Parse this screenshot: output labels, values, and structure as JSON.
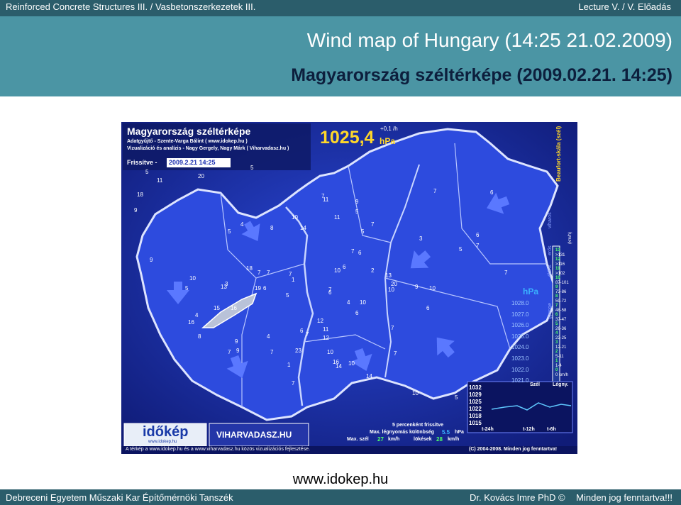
{
  "header": {
    "course": "Reinforced Concrete Structures III. / Vasbetonszerkezetek III.",
    "lecture": "Lecture V. / V. Előadás"
  },
  "slide": {
    "title_en": "Wind map of Hungary (14:25 21.02.2009)",
    "title_hu": "Magyarország széltérképe (2009.02.21. 14:25)",
    "source_url": "www.idokep.hu"
  },
  "map": {
    "heading": "Magyarország széltérképe",
    "collector": "Adatgyűjtő - Szente-Varga Bálint ( www.idokep.hu )",
    "visualization": "Vizualizáció és analízis - Nagy Gergely, Nagy Márk ( Viharvadasz.hu )",
    "refreshed_label": "Frissítve -",
    "refreshed_value": "2009.2.21  14:25",
    "pressure_value": "1025,4",
    "pressure_unit": "hPa",
    "pressure_change": "+0,1 /h",
    "scale_hpa_label": "hPa",
    "scale_hpa_values": [
      "1028.0",
      "1027.0",
      "1026.0",
      "1025.0",
      "1024.0",
      "1023.0",
      "1022.0",
      "1021.0"
    ],
    "beaufort_title": "Beaufort-skála (szél)",
    "beaufort_unit": "(km/h)",
    "beaufort_levels": [
      "13",
      "12",
      "11",
      "10",
      "9",
      "8",
      "7",
      "6",
      "5",
      "4",
      "3",
      "2",
      "1",
      "0"
    ],
    "beaufort_ranges": [
      ">131",
      ">116",
      ">102",
      "87-101",
      "73-86",
      "59-72",
      "48-58",
      "37-47",
      "26-36",
      "22-25",
      "12-21",
      "5-11",
      "1-4",
      "0 km/h"
    ],
    "intensity_words": [
      "viharos",
      "erős",
      "élénk",
      "gyenge"
    ],
    "legend_szel": "Szél",
    "legend_legny": "Légny.",
    "mini_chart_values": [
      "1032",
      "1029",
      "1025",
      "1022",
      "1018",
      "1015"
    ],
    "mini_chart_ticks": [
      "t-24h",
      "t-12h",
      "t-6h"
    ],
    "logo_idokep": "időkép",
    "logo_idokep_url": "www.idokep.hu",
    "logo_vihar": "VIHARVADASZ.HU",
    "stats_pressure_label": "Max. légnyomás különbség",
    "stats_pressure_value": "5.5",
    "stats_pressure_unit": "hPa",
    "stats_wind_label": "Max. szél",
    "stats_wind_value": "27",
    "stats_wind_unit": "km/h",
    "stats_gust_label": "lökések",
    "stats_gust_value": "28",
    "stats_gust_unit": "km/h",
    "refresh_note": "5 percenként frissítve",
    "footer_left": "A térkép a www.idokep.hu és a www.viharvadasz.hu közös vizualizációs fejlesztése.",
    "footer_right": "(C) 2004-2008. Minden jog fenntartva!",
    "station_values": [
      "5",
      "11",
      "20",
      "5",
      "18",
      "9",
      "9",
      "5",
      "4",
      "5",
      "8",
      "10",
      "14",
      "7",
      "11",
      "11",
      "5",
      "9",
      "7",
      "5",
      "3",
      "7",
      "6",
      "6",
      "10",
      "2",
      "7",
      "6",
      "4",
      "10",
      "6",
      "13",
      "18",
      "7",
      "7",
      "19",
      "6",
      "7",
      "1",
      "5",
      "10",
      "3",
      "15",
      "16",
      "16",
      "4",
      "8",
      "9",
      "7",
      "9",
      "7",
      "4",
      "23",
      "6",
      "7",
      "12",
      "11",
      "12",
      "10",
      "16",
      "14",
      "10",
      "14",
      "7",
      "13",
      "20",
      "7",
      "10",
      "6",
      "10",
      "7",
      "5",
      "7",
      "6",
      "7",
      "6",
      "5",
      "10",
      "9",
      "1",
      "7"
    ]
  },
  "footer": {
    "institution": "Debreceni Egyetem Műszaki Kar Építőmérnöki Tanszék",
    "author": "Dr. Kovács Imre PhD ©",
    "rights": "Minden jog fenntartva!!!"
  }
}
